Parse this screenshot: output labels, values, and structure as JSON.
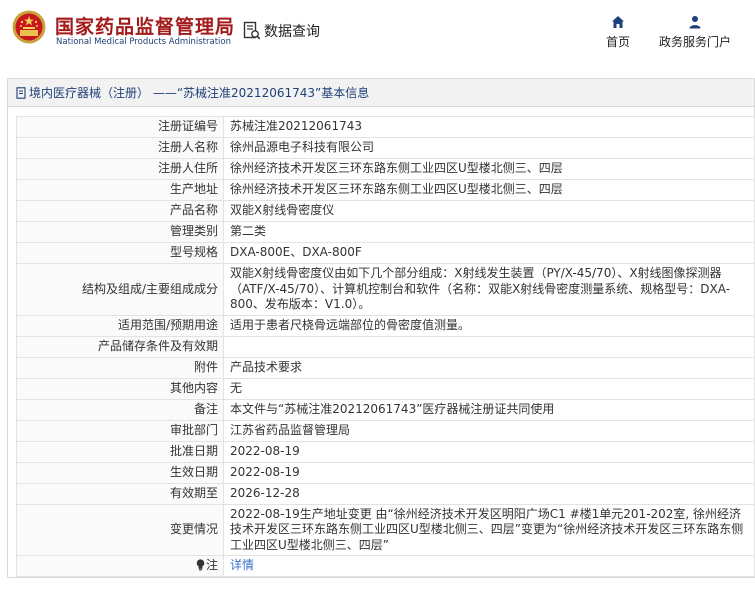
{
  "header": {
    "brand_cn": "国家药品监督管理局",
    "brand_en": "National Medical Products Administration",
    "query_label": "数据查询",
    "nav": [
      {
        "label": "首页",
        "icon": "home-icon"
      },
      {
        "label": "政务服务门户",
        "icon": "user-icon"
      }
    ]
  },
  "panel": {
    "title": "境内医疗器械（注册） ——“苏械注准20212061743”基本信息"
  },
  "rows": [
    {
      "key": "注册证编号",
      "value": "苏械注准20212061743"
    },
    {
      "key": "注册人名称",
      "value": "徐州品源电子科技有限公司"
    },
    {
      "key": "注册人住所",
      "value": "徐州经济技术开发区三环东路东侧工业四区U型楼北侧三、四层"
    },
    {
      "key": "生产地址",
      "value": "徐州经济技术开发区三环东路东侧工业四区U型楼北侧三、四层"
    },
    {
      "key": "产品名称",
      "value": "双能X射线骨密度仪"
    },
    {
      "key": "管理类别",
      "value": "第二类"
    },
    {
      "key": "型号规格",
      "value": "DXA-800E、DXA-800F"
    },
    {
      "key": "结构及组成/主要组成成分",
      "value": "双能X射线骨密度仪由如下几个部分组成：X射线发生装置（PY/X-45/70）、X射线图像探测器（ATF/X-45/70）、计算机控制台和软件（名称：双能X射线骨密度测量系统、规格型号：DXA-800、发布版本：V1.0）。"
    },
    {
      "key": "适用范围/预期用途",
      "value": "适用于患者尺桡骨远端部位的骨密度值测量。"
    },
    {
      "key": "产品储存条件及有效期",
      "value": ""
    },
    {
      "key": "附件",
      "value": "产品技术要求"
    },
    {
      "key": "其他内容",
      "value": "无"
    },
    {
      "key": "备注",
      "value": "本文件与“苏械注准20212061743”医疗器械注册证共同使用"
    },
    {
      "key": "审批部门",
      "value": "江苏省药品监督管理局"
    },
    {
      "key": "批准日期",
      "value": "2022-08-19"
    },
    {
      "key": "生效日期",
      "value": "2022-08-19"
    },
    {
      "key": "有效期至",
      "value": "2026-12-28"
    },
    {
      "key": "变更情况",
      "value": "2022-08-19生产地址变更 由“徐州经济技术开发区明阳广场C1 #楼1单元201-202室, 徐州经济技术开发区三环东路东侧工业四区U型楼北侧三、四层”变更为“徐州经济技术开发区三环东路东侧工业四区U型楼北侧三、四层”"
    }
  ],
  "note": {
    "key": "注",
    "link": "详情"
  },
  "colors": {
    "brand_red": "#a41a1a",
    "brand_blue": "#1f3f7a",
    "link": "#3b71c4",
    "border": "#e3e3e3"
  }
}
